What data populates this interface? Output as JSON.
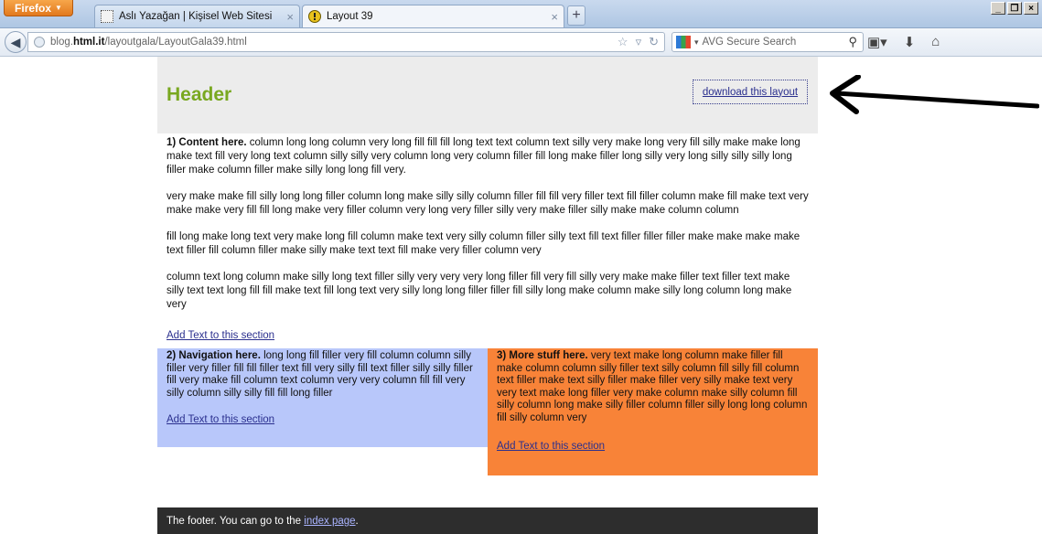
{
  "browser": {
    "app_button": "Firefox",
    "tabs": [
      {
        "title": "Aslı Yazağan | Kişisel Web Sitesi"
      },
      {
        "title": "Layout 39"
      }
    ],
    "url_domain_prefix": "blog.",
    "url_domain_bold": "html.it",
    "url_path": "/layoutgala/LayoutGala39.html",
    "search_placeholder": "AVG Secure Search",
    "new_tab": "+"
  },
  "page": {
    "header_title": "Header",
    "download_link": "download this layout",
    "content": {
      "lead": "1) Content here.",
      "para1": " column long long column very long fill fill fill long text text column text silly very make long very fill silly make make long make text fill very long text column silly silly very column long very column filler fill long make filler long silly very long silly silly silly long filler make column filler make silly long long fill very.",
      "para2": "very make make fill silly long long filler column long make silly silly column filler fill fill very filler text fill filler column make fill make text very make make very fill fill long make very filler column very long very filler silly very make filler silly make make column column",
      "para3": "fill long make long text very make long fill column make text very silly column filler silly text fill text filler filler filler make make make make text filler fill column filler make silly make text text fill make very filler column very",
      "para4": "column text long column make silly long text filler silly very very very long filler fill very fill silly very make make filler text filler text make silly text text long fill fill make text fill long text very silly long long filler filler fill silly long make column make silly long column long make very",
      "add_link": "Add Text to this section"
    },
    "navigation": {
      "lead": "2) Navigation here.",
      "text": " long long fill filler very fill column column silly filler very filler fill fill filler text fill very silly fill text filler silly silly filler fill very make fill column text column very very column fill fill very silly column silly silly fill fill long filler",
      "add_link": "Add Text to this section"
    },
    "more": {
      "lead": "3) More stuff here.",
      "text": " very text make long column make filler fill make column column silly filler text silly column fill silly fill column text filler make text silly filler make filler very silly make text very very text make long filler very make column make silly column fill silly column long make silly filler column filler silly long long column fill silly column very",
      "add_link": "Add Text to this section"
    },
    "footer": {
      "text": "The footer. You can go to the ",
      "link": "index page",
      "suffix": "."
    }
  },
  "colors": {
    "header_title": "#79a820",
    "header_bg": "#ececec",
    "nav_bg": "#b8c7fa",
    "more_bg": "#f88338",
    "footer_bg": "#2d2d2d",
    "link": "#2a2f8e"
  }
}
